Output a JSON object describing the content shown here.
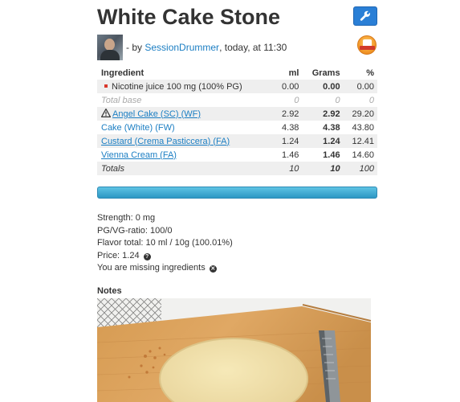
{
  "recipe": {
    "title": "White Cake Stone"
  },
  "byline": {
    "prefix": "- by ",
    "author": "SessionDrummer",
    "suffix": ", today, at 11:30"
  },
  "table": {
    "headers": [
      "Ingredient",
      "ml",
      "Grams",
      "%"
    ],
    "rows": [
      {
        "name": "Nicotine juice 100 mg (100% PG)",
        "ml": "0.00",
        "grams": "0.00",
        "pct": "0.00"
      },
      {
        "name": "Total base",
        "ml": "0",
        "grams": "0",
        "pct": "0"
      },
      {
        "name": "Angel Cake (SC) (WF)",
        "ml": "2.92",
        "grams": "2.92",
        "pct": "29.20"
      },
      {
        "name": "Cake (White) (FW)",
        "ml": "4.38",
        "grams": "4.38",
        "pct": "43.80"
      },
      {
        "name": "Custard (Crema Pasticcera) (FA)",
        "ml": "1.24",
        "grams": "1.24",
        "pct": "12.41"
      },
      {
        "name": "Vienna Cream (FA)",
        "ml": "1.46",
        "grams": "1.46",
        "pct": "14.60"
      },
      {
        "name": "Totals",
        "ml": "10",
        "grams": "10",
        "pct": "100"
      }
    ]
  },
  "progress": {
    "value": 1.0
  },
  "stats": {
    "strength": "Strength: 0 mg",
    "ratio": "PG/VG-ratio: 100/0",
    "flavor_total": "Flavor total: 10 ml / 10g (100.01%)",
    "price": "Price: 1.24",
    "missing": "You are missing ingredients"
  },
  "notes": {
    "title": "Notes"
  },
  "icons": {
    "tool": "wrench-icon",
    "badge": "award-badge-icon",
    "warning": "warning-triangle-icon",
    "help": "question-circle-icon",
    "missing": "x-circle-icon"
  },
  "colors": {
    "accent": "#2a7fd6",
    "link": "#1b7ec3",
    "bar": "#3aa8d3"
  }
}
